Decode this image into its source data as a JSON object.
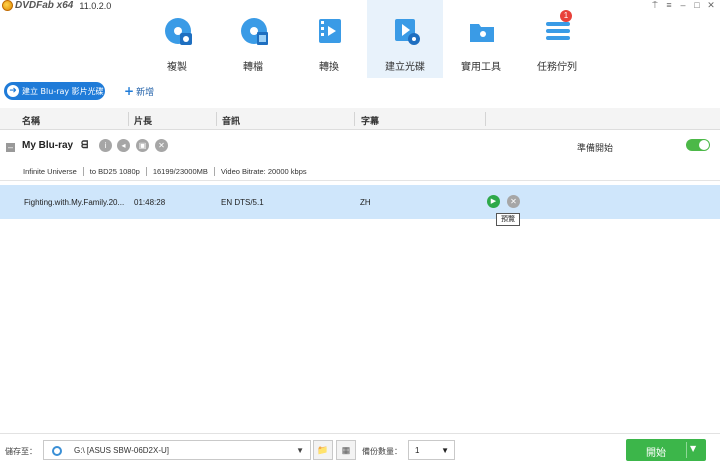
{
  "app": {
    "logo_text": "DVDFab x64",
    "version": "11.0.2.0"
  },
  "modes": [
    {
      "label": "複製",
      "icon": "copy-disc-icon"
    },
    {
      "label": "轉檔",
      "icon": "ripper-disc-icon"
    },
    {
      "label": "轉換",
      "icon": "converter-film-icon"
    },
    {
      "label": "建立光碟",
      "icon": "creator-disc-icon"
    },
    {
      "label": "實用工具",
      "icon": "utilities-folder-icon"
    },
    {
      "label": "任務佇列",
      "icon": "task-queue-icon"
    }
  ],
  "task_queue_badge": "1",
  "toolbar": {
    "create_label": "建立 Blu-ray 影片光碟",
    "add_label": "新增"
  },
  "columns": {
    "name": "名稱",
    "length": "片長",
    "audio": "音訊",
    "subtitle": "字幕"
  },
  "disc": {
    "name": "My Blu-ray",
    "status": "準備開始",
    "info": [
      "Infinite Universe",
      "to BD25 1080p",
      "16199/23000MB",
      "Video Bitrate: 20000 kbps"
    ]
  },
  "title": {
    "name": "Fighting.with.My.Family.20...",
    "length": "01:48:28",
    "audio": "EN  DTS/5.1",
    "subtitle": "ZH",
    "tooltip": "預覽"
  },
  "footer": {
    "save_label": "儲存至：",
    "target": "G:\\ [ASUS SBW-06D2X-U]",
    "copies_label": "備份數量：",
    "copies_value": "1",
    "start_label": "開始"
  },
  "colors": {
    "accent": "#1f7bd8",
    "start_green": "#3cb64a",
    "row_selected": "#cfe6fb"
  }
}
